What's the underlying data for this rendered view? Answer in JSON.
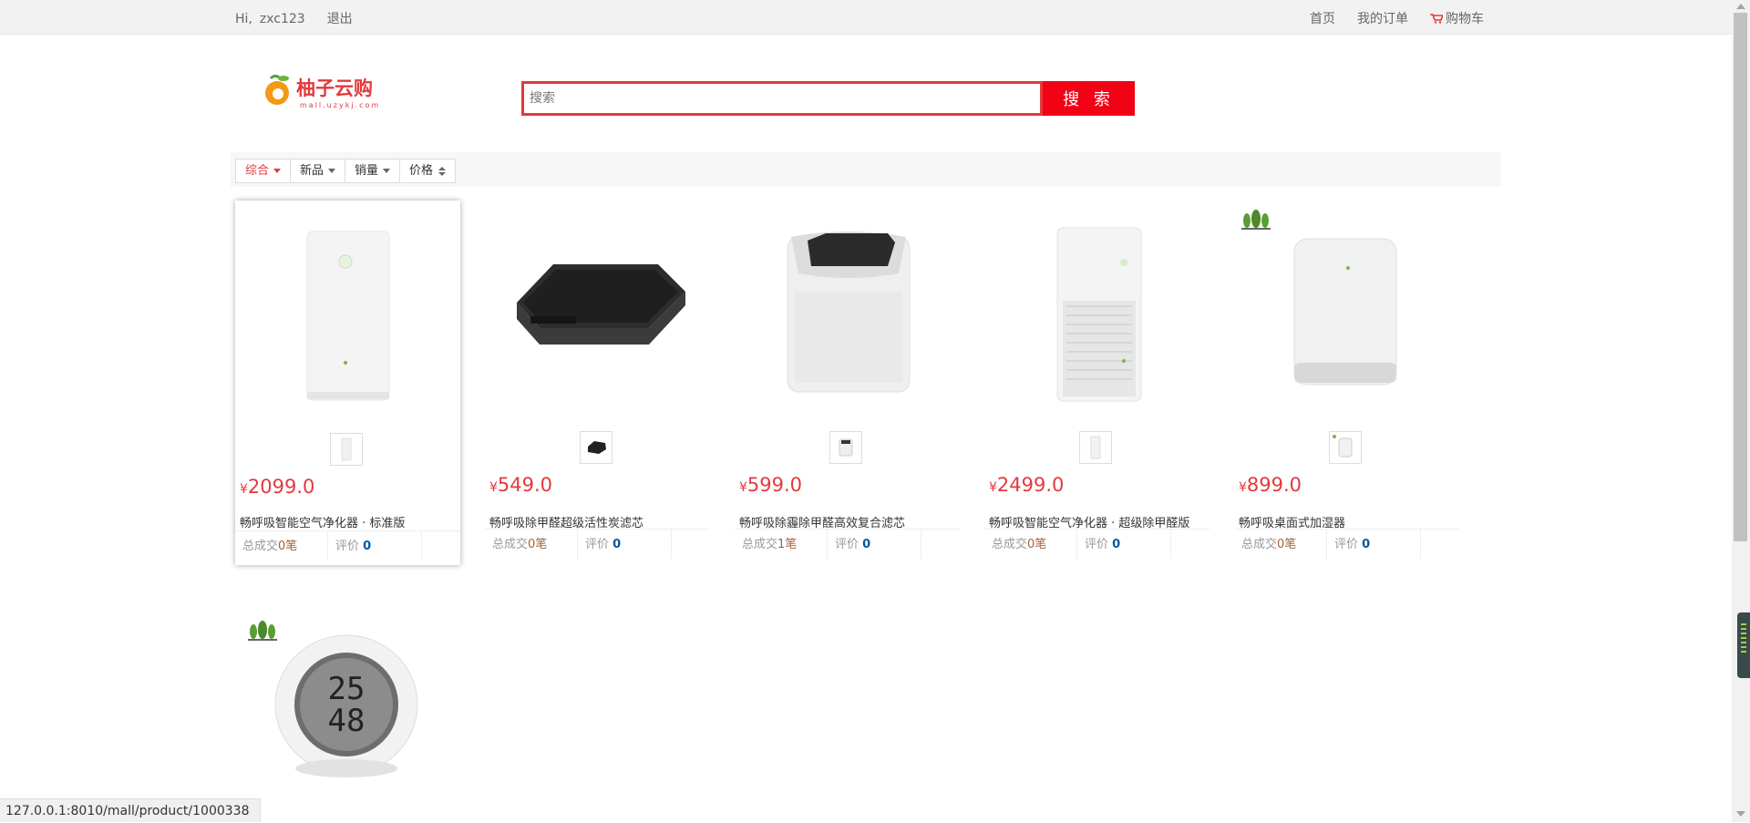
{
  "topbar": {
    "greeting": "Hi,",
    "username": "zxc123",
    "logout": "退出",
    "home": "首页",
    "orders": "我的订单",
    "cart": "购物车"
  },
  "logo": {
    "brand": "柚子云购",
    "domain": "mall.uzykj.com"
  },
  "search": {
    "placeholder": "搜索",
    "button": "搜 索"
  },
  "filters": [
    {
      "label": "综合",
      "active": true
    },
    {
      "label": "新品"
    },
    {
      "label": "销量"
    },
    {
      "label": "价格"
    }
  ],
  "products": [
    {
      "currency": "¥",
      "price": "2099.0",
      "name": "畅呼吸智能空气净化器 · 标准版",
      "sales_label": "总成交",
      "sales": "0笔",
      "review_label": "评价",
      "reviews": "0"
    },
    {
      "currency": "¥",
      "price": "549.0",
      "name": "畅呼吸除甲醛超级活性炭滤芯",
      "sales_label": "总成交",
      "sales": "0笔",
      "review_label": "评价",
      "reviews": "0"
    },
    {
      "currency": "¥",
      "price": "599.0",
      "name": "畅呼吸除霾除甲醛高效复合滤芯",
      "sales_label": "总成交",
      "sales": "1笔",
      "review_label": "评价",
      "reviews": "0"
    },
    {
      "currency": "¥",
      "price": "2499.0",
      "name": "畅呼吸智能空气净化器 · 超级除甲醛版",
      "sales_label": "总成交",
      "sales": "0笔",
      "review_label": "评价",
      "reviews": "0"
    },
    {
      "currency": "¥",
      "price": "899.0",
      "name": "畅呼吸桌面式加湿器",
      "sales_label": "总成交",
      "sales": "0笔",
      "review_label": "评价",
      "reviews": "0"
    }
  ],
  "thermometer": {
    "temp": "25",
    "humidity": "48"
  },
  "status_url": "127.0.0.1:8010/mall/product/1000338",
  "colors": {
    "accent": "#e4393c",
    "button": "#f10215",
    "sales": "#a7633a",
    "reviews": "#005aa0"
  }
}
